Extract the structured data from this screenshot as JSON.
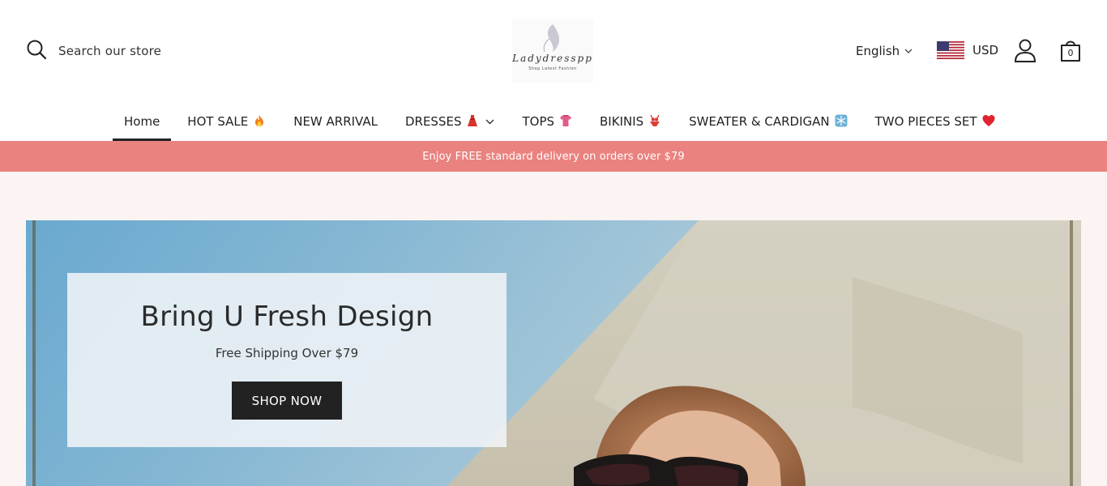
{
  "header": {
    "search": {
      "label": "Search our store",
      "icon": "search-icon"
    },
    "logo": {
      "wordmark": "Ladydresspp",
      "tagline": "Shop Latest Fashion"
    },
    "language": {
      "label": "English",
      "icon": "chevron-down-icon"
    },
    "currency": {
      "label": "USD",
      "flag": "us-flag-icon"
    },
    "account": {
      "icon": "user-icon"
    },
    "cart": {
      "icon": "shopping-bag-icon",
      "count": "0"
    }
  },
  "nav": {
    "items": [
      {
        "label": "Home",
        "active": true
      },
      {
        "label": "HOT SALE",
        "emoji": "fire-emoji"
      },
      {
        "label": "NEW ARRIVAL"
      },
      {
        "label": "DRESSES",
        "emoji": "dress-emoji",
        "has_dropdown": true
      },
      {
        "label": "TOPS",
        "emoji": "shirt-emoji"
      },
      {
        "label": "BIKINIS",
        "emoji": "bikini-emoji"
      },
      {
        "label": "SWEATER & CARDIGAN",
        "emoji": "snowflake-emoji"
      },
      {
        "label": "TWO PIECES SET",
        "emoji": "heart-emoji"
      }
    ]
  },
  "announcement": {
    "text": "Enjoy FREE standard delivery on orders over $79",
    "color": "#ea827f"
  },
  "hero": {
    "title": "Bring U Fresh Design",
    "subtitle": "Free Shipping Over $79",
    "button": "SHOP NOW"
  },
  "colors": {
    "accent_dark": "#222222",
    "announcement_bg": "#ea827f",
    "page_bg": "#fbf4f3"
  }
}
